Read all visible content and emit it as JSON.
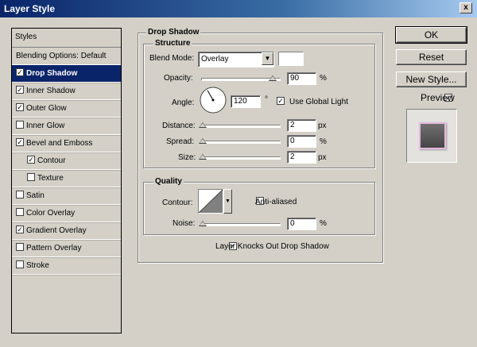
{
  "window": {
    "title": "Layer Style",
    "close_glyph": "x"
  },
  "styles_panel": {
    "header": "Styles",
    "items": [
      {
        "label": "Blending Options: Default",
        "checkbox": false,
        "checked": false,
        "selected": false,
        "indent": false
      },
      {
        "label": "Drop Shadow",
        "checkbox": true,
        "checked": true,
        "selected": true,
        "indent": false
      },
      {
        "label": "Inner Shadow",
        "checkbox": true,
        "checked": true,
        "selected": false,
        "indent": false
      },
      {
        "label": "Outer Glow",
        "checkbox": true,
        "checked": true,
        "selected": false,
        "indent": false
      },
      {
        "label": "Inner Glow",
        "checkbox": true,
        "checked": false,
        "selected": false,
        "indent": false
      },
      {
        "label": "Bevel and Emboss",
        "checkbox": true,
        "checked": true,
        "selected": false,
        "indent": false
      },
      {
        "label": "Contour",
        "checkbox": true,
        "checked": true,
        "selected": false,
        "indent": true
      },
      {
        "label": "Texture",
        "checkbox": true,
        "checked": false,
        "selected": false,
        "indent": true
      },
      {
        "label": "Satin",
        "checkbox": true,
        "checked": false,
        "selected": false,
        "indent": false
      },
      {
        "label": "Color Overlay",
        "checkbox": true,
        "checked": false,
        "selected": false,
        "indent": false
      },
      {
        "label": "Gradient Overlay",
        "checkbox": true,
        "checked": true,
        "selected": false,
        "indent": false
      },
      {
        "label": "Pattern Overlay",
        "checkbox": true,
        "checked": false,
        "selected": false,
        "indent": false
      },
      {
        "label": "Stroke",
        "checkbox": true,
        "checked": false,
        "selected": false,
        "indent": false
      }
    ]
  },
  "drop_shadow": {
    "group_title": "Drop Shadow",
    "structure_title": "Structure",
    "blend_mode_label": "Blend Mode:",
    "blend_mode_value": "Overlay",
    "shadow_color": "#ffffff",
    "opacity_label": "Opacity:",
    "opacity_value": "90",
    "opacity_level_percent": 90,
    "opacity_unit": "%",
    "angle_label": "Angle:",
    "angle_value": "120",
    "angle_degrees": 120,
    "angle_unit": "°",
    "use_global_light_label": "Use Global Light",
    "use_global_light_checked": true,
    "distance_label": "Distance:",
    "distance_value": "2",
    "distance_unit": "px",
    "spread_label": "Spread:",
    "spread_value": "0",
    "spread_unit": "%",
    "size_label": "Size:",
    "size_value": "2",
    "size_unit": "px",
    "quality_title": "Quality",
    "contour_label": "Contour:",
    "anti_aliased_label": "Anti-aliased",
    "anti_aliased_checked": false,
    "noise_label": "Noise:",
    "noise_value": "0",
    "noise_unit": "%",
    "knocks_out_label": "Layer Knocks Out Drop Shadow",
    "knocks_out_checked": true
  },
  "buttons": {
    "ok": "OK",
    "reset": "Reset",
    "new_style": "New Style..."
  },
  "preview": {
    "label": "Preview",
    "checked": true
  },
  "colors": {
    "titlebar": "#0a246a",
    "selection": "#0a246a",
    "dialog_bg": "#d4d0c8"
  }
}
